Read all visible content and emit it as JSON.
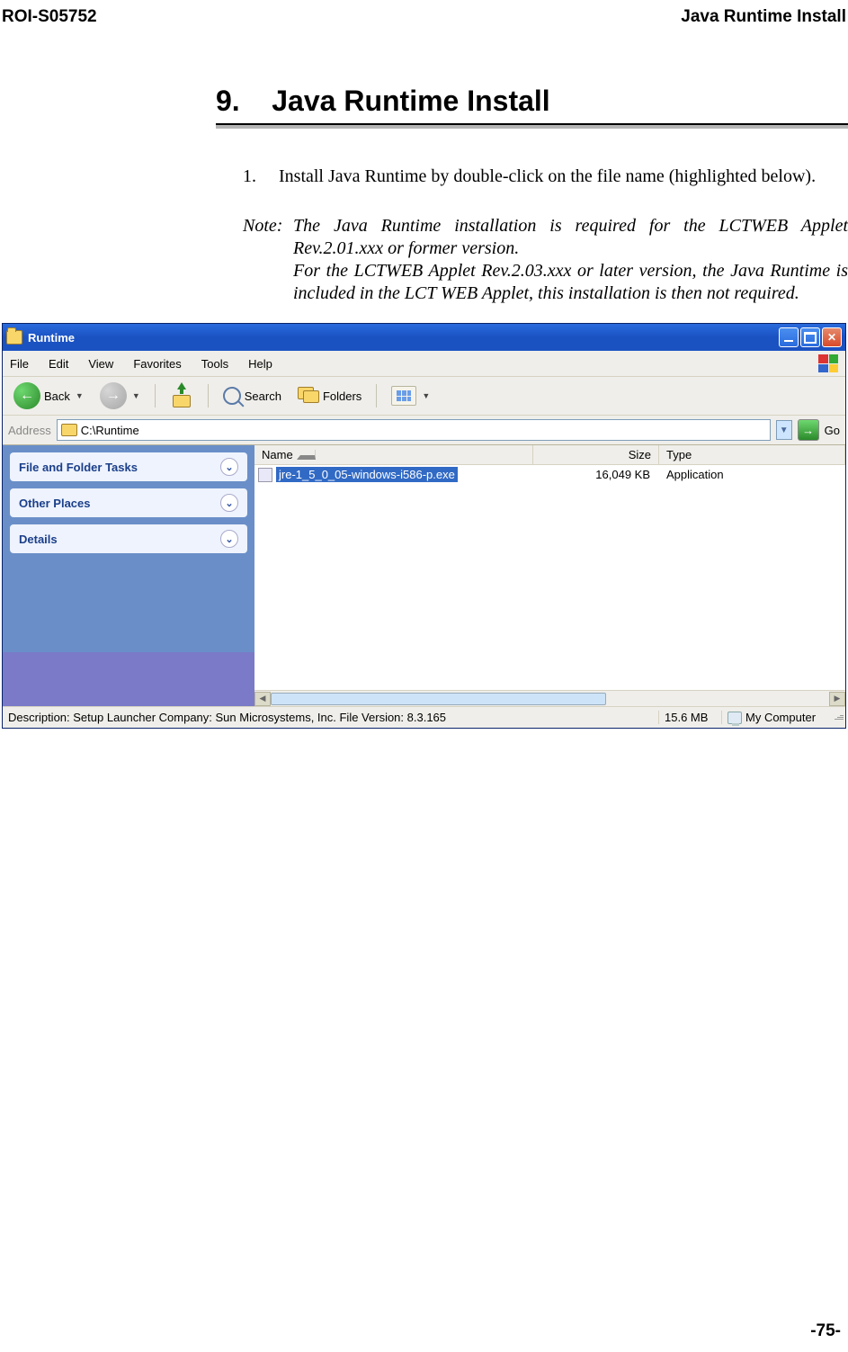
{
  "header": {
    "left": "ROI-S05752",
    "right": "Java Runtime Install"
  },
  "section": {
    "number": "9.",
    "title": "Java Runtime Install"
  },
  "step": {
    "num": "1.",
    "text": "Install Java Runtime by double-click on the file name (highlighted below)."
  },
  "note": {
    "label": "Note:",
    "line1": "The Java Runtime installation is required for the LCTWEB Applet Rev.2.01.xxx or former version.",
    "line2": "For the LCTWEB Applet Rev.2.03.xxx or later version, the Java Runtime is included in the LCT WEB Applet, this installation is then not required."
  },
  "explorer": {
    "title": "Runtime",
    "menu": [
      "File",
      "Edit",
      "View",
      "Favorites",
      "Tools",
      "Help"
    ],
    "toolbar": {
      "back": "Back",
      "search": "Search",
      "folders": "Folders"
    },
    "address": {
      "label": "Address",
      "path": "C:\\Runtime",
      "go": "Go"
    },
    "sidebar": {
      "panels": [
        "File and Folder Tasks",
        "Other Places",
        "Details"
      ]
    },
    "columns": {
      "name": "Name",
      "size": "Size",
      "type": "Type"
    },
    "file": {
      "name": "jre-1_5_0_05-windows-i586-p.exe",
      "size": "16,049 KB",
      "type": "Application"
    },
    "status": {
      "desc": "Description: Setup Launcher Company: Sun Microsystems, Inc. File Version: 8.3.165",
      "size": "15.6 MB",
      "location": "My Computer"
    }
  },
  "footer": "-75-"
}
